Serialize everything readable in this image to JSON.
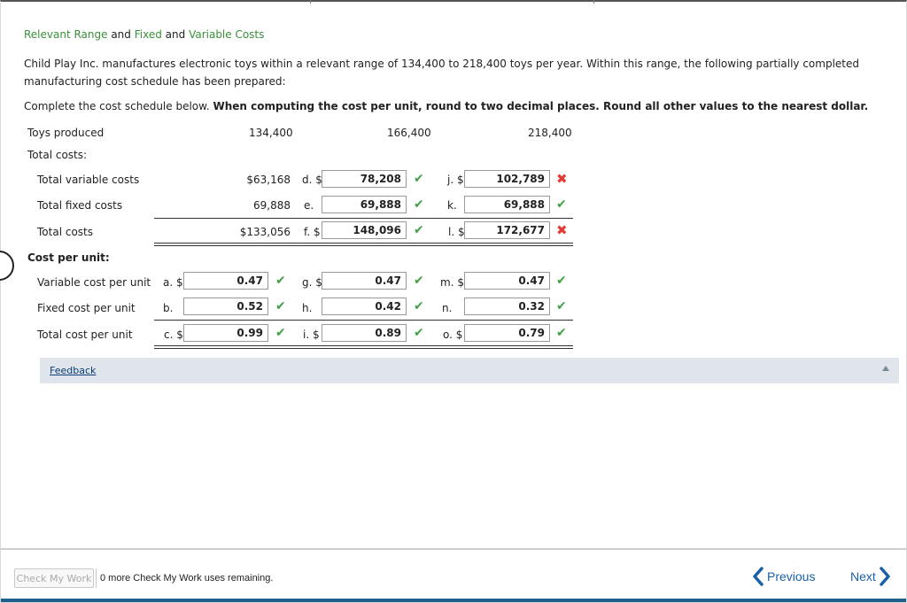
{
  "title": {
    "part1": "Relevant Range",
    "and1": " and ",
    "part2": "Fixed",
    "and2": " and ",
    "part3": "Variable Costs"
  },
  "intro": "Child Play Inc. manufactures electronic toys within a relevant range of 134,400 to 218,400 toys per year. Within this range, the following partially completed manufacturing cost schedule has been prepared:",
  "instruction": {
    "plain": "Complete the cost schedule below. ",
    "bold": "When computing the cost per unit, round to two decimal places. Round all other values to the nearest dollar."
  },
  "schedule": {
    "toys_label": "Toys produced",
    "toys": [
      "134,400",
      "166,400",
      "218,400"
    ],
    "total_costs_label": "Total costs:",
    "tvc": {
      "label": "Total variable costs",
      "given": "$63,168",
      "l1": "d. $",
      "v1": "78,208",
      "l2": "j. $",
      "v2": "102,789"
    },
    "tfc": {
      "label": "Total fixed costs",
      "given": "69,888",
      "l1": "e.",
      "v1": "69,888",
      "l2": "k.",
      "v2": "69,888"
    },
    "tc": {
      "label": "Total costs",
      "given": "$133,056",
      "l1": "f. $",
      "v1": "148,096",
      "l2": "l. $",
      "v2": "172,677"
    },
    "cpu_label": "Cost per unit:",
    "vcpu": {
      "label": "Variable cost per unit",
      "l0": "a. $",
      "v0": "0.47",
      "l1": "g. $",
      "v1": "0.47",
      "l2": "m. $",
      "v2": "0.47"
    },
    "fcpu": {
      "label": "Fixed cost per unit",
      "l0": "b.",
      "v0": "0.52",
      "l1": "h.",
      "v1": "0.42",
      "l2": "n.",
      "v2": "0.32"
    },
    "tcpu": {
      "label": "Total cost per unit",
      "l0": "c. $",
      "v0": "0.99",
      "l1": "i. $",
      "v1": "0.89",
      "l2": "o. $",
      "v2": "0.79"
    }
  },
  "marks": {
    "correct": "✔",
    "incorrect": "✖"
  },
  "feedback_label": "Feedback",
  "footer": {
    "check_button": "Check My Work",
    "remaining": "0 more Check My Work uses remaining.",
    "previous": "Previous",
    "next": "Next"
  },
  "colors": {
    "accent": "#1a5fa8",
    "title_green": "#3a8f3a",
    "correct": "#43a047",
    "incorrect": "#e53935"
  }
}
